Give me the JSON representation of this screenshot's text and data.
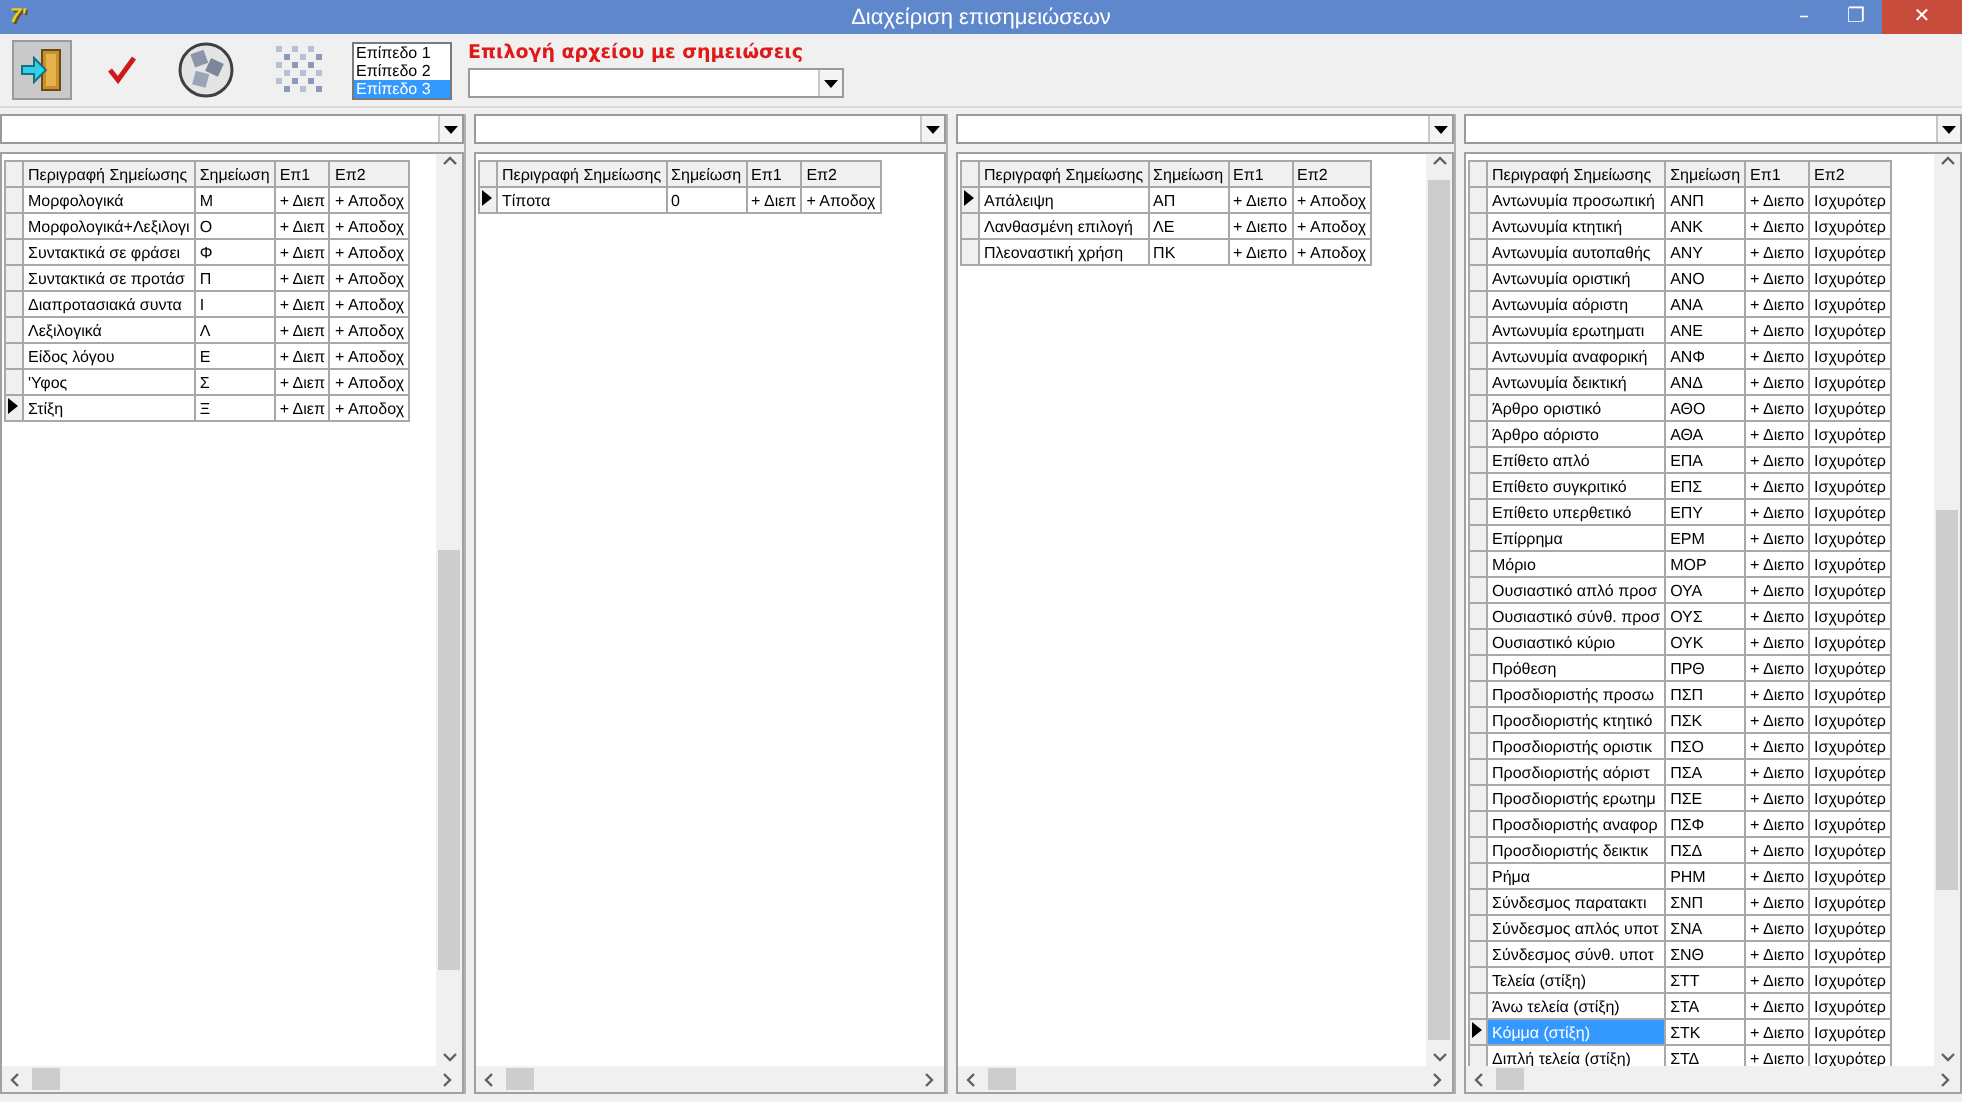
{
  "window": {
    "icon_label": "7'",
    "title": "Διαχείριση επισημειώσεων",
    "controls": [
      {
        "kind": "minimize",
        "label": "–"
      },
      {
        "kind": "restore",
        "label": "❐"
      },
      {
        "kind": "close",
        "label": "✕"
      }
    ]
  },
  "toolbar": {
    "levels": [
      {
        "label": "Επίπεδο 1",
        "selected": false
      },
      {
        "label": "Επίπεδο 2",
        "selected": false
      },
      {
        "label": "Επίπεδο 3",
        "selected": true
      }
    ],
    "file_label": "Επιλογή αρχείου με σημειώσεις"
  },
  "panels": [
    {
      "scrollable": true,
      "columns": [
        "Περιγραφή Σημείωσης",
        "Σημείωση",
        "Επ1",
        "Επ2"
      ],
      "rows": [
        {
          "cells": [
            "Μορφολογικά",
            "Μ",
            "+ Διεπ",
            "+ Αποδοχ"
          ],
          "current": false
        },
        {
          "cells": [
            "Μορφολογικά+Λεξιλογι",
            "Ο",
            "+ Διεπ",
            "+ Αποδοχ"
          ],
          "current": false
        },
        {
          "cells": [
            "Συντακτικά σε φράσει",
            "Φ",
            "+ Διεπ",
            "+ Αποδοχ"
          ],
          "current": false
        },
        {
          "cells": [
            "Συντακτικά σε προτάσ",
            "Π",
            "+ Διεπ",
            "+ Αποδοχ"
          ],
          "current": false
        },
        {
          "cells": [
            "Διαπροτασιακά συντα",
            "Ι",
            "+ Διεπ",
            "+ Αποδοχ"
          ],
          "current": false
        },
        {
          "cells": [
            "Λεξιλογικά",
            "Λ",
            "+ Διεπ",
            "+ Αποδοχ"
          ],
          "current": false
        },
        {
          "cells": [
            "Είδος λόγου",
            "Ε",
            "+ Διεπ",
            "+ Αποδοχ"
          ],
          "current": false
        },
        {
          "cells": [
            "'Υφος",
            "Σ",
            "+ Διεπ",
            "+ Αποδοχ"
          ],
          "current": false
        },
        {
          "cells": [
            "Στίξη",
            "Ξ",
            "+ Διεπ",
            "+ Αποδοχ"
          ],
          "current": true
        }
      ]
    },
    {
      "scrollable": false,
      "columns": [
        "Περιγραφή Σημείωσης",
        "Σημείωση",
        "Επ1",
        "Επ2"
      ],
      "rows": [
        {
          "cells": [
            "Τίποτα",
            "0",
            "+ Διεπ",
            "+ Αποδοχ"
          ],
          "current": true
        }
      ]
    },
    {
      "scrollable": true,
      "columns": [
        "Περιγραφή Σημείωσης",
        "Σημείωση",
        "Επ1",
        "Επ2"
      ],
      "rows": [
        {
          "cells": [
            "Απάλειψη",
            "ΑΠ",
            "+ Διεπο",
            "+ Αποδοχ"
          ],
          "current": true
        },
        {
          "cells": [
            "Λανθασμένη επιλογή",
            "ΛΕ",
            "+ Διεπο",
            "+ Αποδοχ"
          ],
          "current": false
        },
        {
          "cells": [
            "Πλεοναστική χρήση",
            "ΠΚ",
            "+ Διεπο",
            "+ Αποδοχ"
          ],
          "current": false
        }
      ]
    },
    {
      "scrollable": true,
      "columns": [
        "Περιγραφή Σημείωσης",
        "Σημείωση",
        "Επ1",
        "Επ2"
      ],
      "rows": [
        {
          "cells": [
            "Αντωνυμία προσωπική",
            "ΑΝΠ",
            "+ Διεπο",
            "Ισχυρότερ"
          ],
          "current": false,
          "selected": false
        },
        {
          "cells": [
            "Αντωνυμία κτητική",
            "ΑΝΚ",
            "+ Διεπο",
            "Ισχυρότερ"
          ],
          "current": false,
          "selected": false
        },
        {
          "cells": [
            "Αντωνυμία αυτοπαθής",
            "ΑΝΥ",
            "+ Διεπο",
            "Ισχυρότερ"
          ],
          "current": false,
          "selected": false
        },
        {
          "cells": [
            "Αντωνυμία οριστική",
            "ΑΝΟ",
            "+ Διεπο",
            "Ισχυρότερ"
          ],
          "current": false,
          "selected": false
        },
        {
          "cells": [
            "Αντωνυμία αόριστη",
            "ΑΝΑ",
            "+ Διεπο",
            "Ισχυρότερ"
          ],
          "current": false,
          "selected": false
        },
        {
          "cells": [
            "Αντωνυμία ερωτηματι",
            "ΑΝΕ",
            "+ Διεπο",
            "Ισχυρότερ"
          ],
          "current": false,
          "selected": false
        },
        {
          "cells": [
            "Αντωνυμία αναφορική",
            "ΑΝΦ",
            "+ Διεπο",
            "Ισχυρότερ"
          ],
          "current": false,
          "selected": false
        },
        {
          "cells": [
            "Αντωνυμία δεικτική",
            "ΑΝΔ",
            "+ Διεπο",
            "Ισχυρότερ"
          ],
          "current": false,
          "selected": false
        },
        {
          "cells": [
            "Άρθρο οριστικό",
            "ΑΘΟ",
            "+ Διεπο",
            "Ισχυρότερ"
          ],
          "current": false,
          "selected": false
        },
        {
          "cells": [
            "Άρθρο αόριστο",
            "ΑΘΑ",
            "+ Διεπο",
            "Ισχυρότερ"
          ],
          "current": false,
          "selected": false
        },
        {
          "cells": [
            "Επίθετο απλό",
            "ΕΠΑ",
            "+ Διεπο",
            "Ισχυρότερ"
          ],
          "current": false,
          "selected": false
        },
        {
          "cells": [
            "Επίθετο συγκριτικό",
            "ΕΠΣ",
            "+ Διεπο",
            "Ισχυρότερ"
          ],
          "current": false,
          "selected": false
        },
        {
          "cells": [
            "Επίθετο υπερθετικό",
            "ΕΠΥ",
            "+ Διεπο",
            "Ισχυρότερ"
          ],
          "current": false,
          "selected": false
        },
        {
          "cells": [
            "Επίρρημα",
            "ΕΡΜ",
            "+ Διεπο",
            "Ισχυρότερ"
          ],
          "current": false,
          "selected": false
        },
        {
          "cells": [
            "Μόριο",
            "ΜΟΡ",
            "+ Διεπο",
            "Ισχυρότερ"
          ],
          "current": false,
          "selected": false
        },
        {
          "cells": [
            "Ουσιαστικό απλό προσ",
            "ΟΥΑ",
            "+ Διεπο",
            "Ισχυρότερ"
          ],
          "current": false,
          "selected": false
        },
        {
          "cells": [
            "Ουσιαστικό σύνθ. προσ",
            "ΟΥΣ",
            "+ Διεπο",
            "Ισχυρότερ"
          ],
          "current": false,
          "selected": false
        },
        {
          "cells": [
            "Ουσιαστικό κύριο",
            "ΟΥΚ",
            "+ Διεπο",
            "Ισχυρότερ"
          ],
          "current": false,
          "selected": false
        },
        {
          "cells": [
            "Πρόθεση",
            "ΠΡΘ",
            "+ Διεπο",
            "Ισχυρότερ"
          ],
          "current": false,
          "selected": false
        },
        {
          "cells": [
            "Προσδιοριστής προσω",
            "ΠΣΠ",
            "+ Διεπο",
            "Ισχυρότερ"
          ],
          "current": false,
          "selected": false
        },
        {
          "cells": [
            "Προσδιοριστής κτητικό",
            "ΠΣΚ",
            "+ Διεπο",
            "Ισχυρότερ"
          ],
          "current": false,
          "selected": false
        },
        {
          "cells": [
            "Προσδιοριστής οριστικ",
            "ΠΣΟ",
            "+ Διεπο",
            "Ισχυρότερ"
          ],
          "current": false,
          "selected": false
        },
        {
          "cells": [
            "Προσδιοριστής αόριστ",
            "ΠΣΑ",
            "+ Διεπο",
            "Ισχυρότερ"
          ],
          "current": false,
          "selected": false
        },
        {
          "cells": [
            "Προσδιοριστής ερωτημ",
            "ΠΣΕ",
            "+ Διεπο",
            "Ισχυρότερ"
          ],
          "current": false,
          "selected": false
        },
        {
          "cells": [
            "Προσδιοριστής αναφορ",
            "ΠΣΦ",
            "+ Διεπο",
            "Ισχυρότερ"
          ],
          "current": false,
          "selected": false
        },
        {
          "cells": [
            "Προσδιοριστής δεικτικ",
            "ΠΣΔ",
            "+ Διεπο",
            "Ισχυρότερ"
          ],
          "current": false,
          "selected": false
        },
        {
          "cells": [
            "Ρήμα",
            "ΡΗΜ",
            "+ Διεπο",
            "Ισχυρότερ"
          ],
          "current": false,
          "selected": false
        },
        {
          "cells": [
            "Σύνδεσμος παρατακτι",
            "ΣΝΠ",
            "+ Διεπο",
            "Ισχυρότερ"
          ],
          "current": false,
          "selected": false
        },
        {
          "cells": [
            "Σύνδεσμος απλός υποτ",
            "ΣΝΑ",
            "+ Διεπο",
            "Ισχυρότερ"
          ],
          "current": false,
          "selected": false
        },
        {
          "cells": [
            "Σύνδεσμος σύνθ. υποτ",
            "ΣΝΘ",
            "+ Διεπο",
            "Ισχυρότερ"
          ],
          "current": false,
          "selected": false
        },
        {
          "cells": [
            "Τελεία (στίξη)",
            "ΣΤΤ",
            "+ Διεπο",
            "Ισχυρότερ"
          ],
          "current": false,
          "selected": false
        },
        {
          "cells": [
            "Άνω τελεία (στίξη)",
            "ΣΤΑ",
            "+ Διεπο",
            "Ισχυρότερ"
          ],
          "current": false,
          "selected": false
        },
        {
          "cells": [
            "Κόμμα (στίξη)",
            "ΣΤΚ",
            "+ Διεπο",
            "Ισχυρότερ"
          ],
          "current": true,
          "selected": true
        },
        {
          "cells": [
            "Διπλή τελεία (στίξη)",
            "ΣΤΔ",
            "+ Διεπο",
            "Ισχυρότερ"
          ],
          "current": false,
          "selected": false
        }
      ]
    }
  ]
}
